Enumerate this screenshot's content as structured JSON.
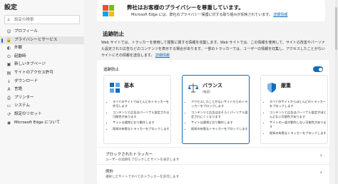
{
  "sidebar": {
    "title": "設定",
    "search_placeholder": "設定の検索",
    "items": [
      {
        "label": "プロフィール",
        "icon": "person-icon",
        "glyph": "☺"
      },
      {
        "label": "プライバシーとサービス",
        "icon": "lock-icon",
        "glyph": "🔒",
        "active": true
      },
      {
        "label": "外観",
        "icon": "appearance-icon",
        "glyph": "◐"
      },
      {
        "label": "起動時",
        "icon": "power-icon",
        "glyph": "⏻"
      },
      {
        "label": "新しいタブページ",
        "icon": "new-tab-icon",
        "glyph": "▣"
      },
      {
        "label": "サイトのアクセス許可",
        "icon": "site-permissions-icon",
        "glyph": "▤"
      },
      {
        "label": "ダウンロード",
        "icon": "download-icon",
        "glyph": "↓"
      },
      {
        "label": "言語",
        "icon": "language-icon",
        "glyph": "A"
      },
      {
        "label": "プリンター",
        "icon": "printer-icon",
        "glyph": "⎙"
      },
      {
        "label": "システム",
        "icon": "system-icon",
        "glyph": "▭"
      },
      {
        "label": "設定のリセット",
        "icon": "reset-icon",
        "glyph": "↺"
      },
      {
        "label": "Microsoft Edge について",
        "icon": "edge-icon",
        "glyph": "◉"
      }
    ]
  },
  "banner": {
    "title": "弊社はお客様のプライバシーを尊重しています。",
    "text": "Microsoft Edge には、弊社のプライバシー保護に対する取り組みが反映されています。",
    "link": "詳細情報"
  },
  "tracking": {
    "title": "追跡防止",
    "desc1": "Web サイトでは、トラッカーを使用して閲覧に関する情報を収集します。Web サイトでは、この情報を使用して、サイトの改善やパーソナル設定された広告などのコンテンツを表示する場合があります。一部のトラッカーでは、ユーザーの情報を収集し、アクセスしたことがないサイトにその情報を送信します。",
    "desc_link": "詳細情報",
    "toggle_label": "追跡防止",
    "toggle_on": true
  },
  "cards": [
    {
      "title": "基本",
      "sub": "",
      "icon": "basic-icon",
      "selected": false,
      "bullets": [
        "すべてのサイトでほとんどのトラッカーを許可します",
        "コンテンツと広告はパーソナル設定される可能性があります",
        "サイトは通常どおり動作します",
        "既知の有害なトラッカーをブロックします"
      ]
    },
    {
      "title": "バランス",
      "sub": "(推奨)",
      "icon": "balance-icon",
      "selected": true,
      "bullets": [
        "アクセスしたことがないサイトからのトラッカーをブロックします",
        "コンテンツと広告はおそらくパーソナル設定されにくくなります",
        "サイトは通常どおり動作します",
        "既知の有害なトラッカーをブロックします"
      ]
    },
    {
      "title": "厳重",
      "sub": "",
      "icon": "strict-shield-icon",
      "selected": false,
      "bullets": [
        "すべてのサイトからほとんどのトラッカーをブロックします",
        "コンテンツと広告はパーソナル設定がほとんどない可能性があります",
        "サイトの一部が動作しない可能性があります",
        "既知の有害なトラッカーをブロックします"
      ]
    }
  ],
  "blocked_trackers": {
    "title": "ブロックされたトラッカー",
    "desc": "ユーザーの追跡をブロックしたサイトを表示します"
  },
  "exceptions": {
    "title": "例外",
    "desc": "選択したサイトですべてのトラッカーを許可します"
  },
  "colors": {
    "accent": "#0f6cbd",
    "ms_red": "#f25022",
    "ms_green": "#7fba00",
    "ms_blue": "#00a4ef",
    "ms_yellow": "#ffb900"
  }
}
